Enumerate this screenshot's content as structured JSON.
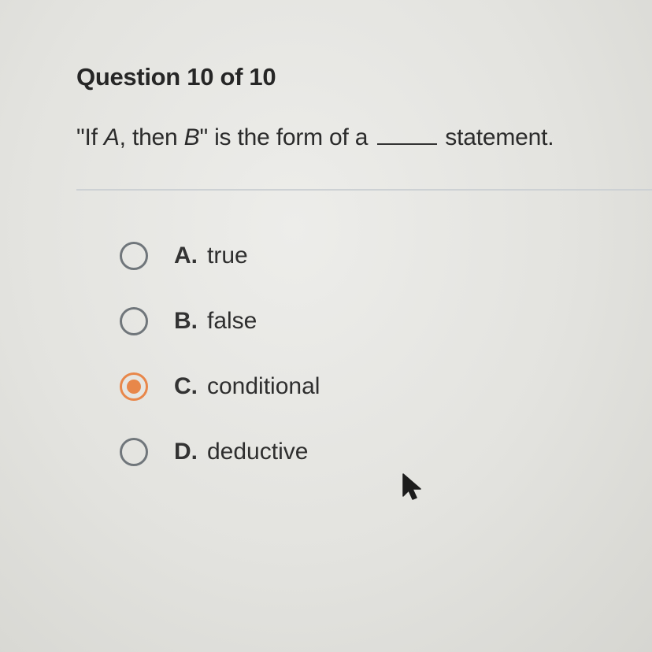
{
  "question": {
    "header": "Question 10 of 10",
    "prompt_open": "\"If ",
    "var_a": "A",
    "prompt_mid": ", then ",
    "var_b": "B",
    "prompt_after_b": "\" is the form of a",
    "prompt_end": "statement."
  },
  "options": [
    {
      "letter": "A.",
      "text": "true",
      "selected": false
    },
    {
      "letter": "B.",
      "text": "false",
      "selected": false
    },
    {
      "letter": "C.",
      "text": "conditional",
      "selected": true
    },
    {
      "letter": "D.",
      "text": "deductive",
      "selected": false
    }
  ],
  "colors": {
    "selected_radio": "#e8874a",
    "unselected_radio": "#70767b"
  },
  "icons": {
    "cursor": "mouse-pointer-icon"
  }
}
